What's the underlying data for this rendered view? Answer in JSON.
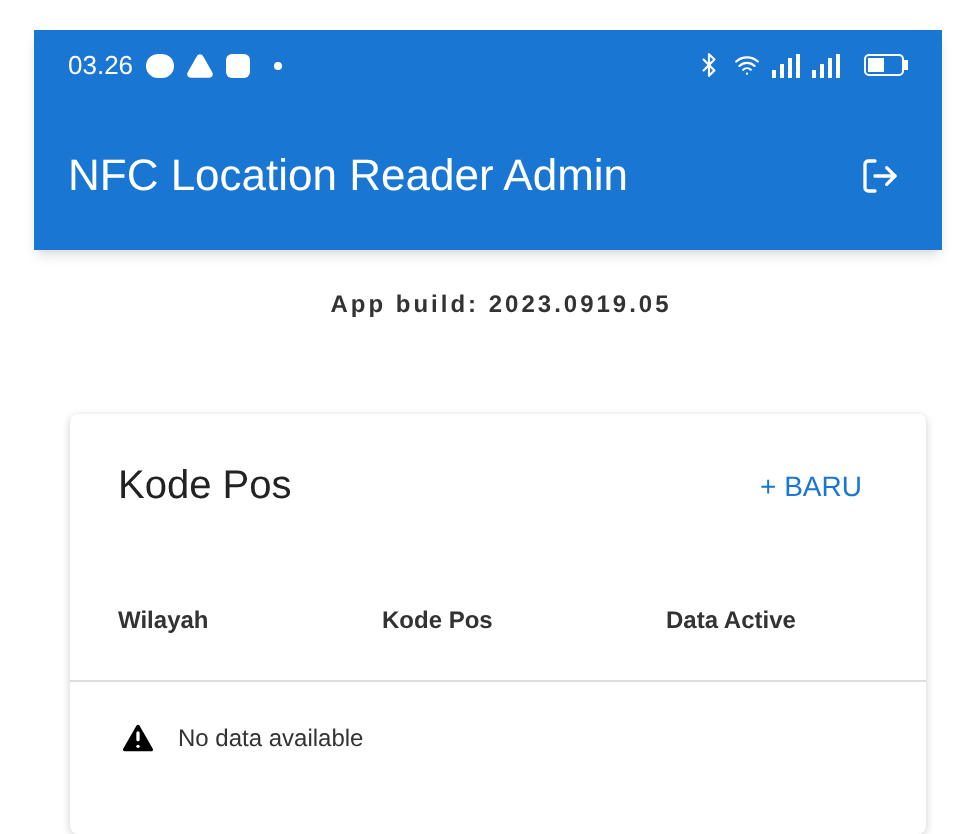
{
  "status_bar": {
    "time": "03.26"
  },
  "app_bar": {
    "title": "NFC Location Reader Admin"
  },
  "build_info": "App build: 2023.0919.05",
  "card": {
    "title": "Kode Pos",
    "new_button": "+ BARU",
    "table": {
      "columns": [
        "Wilayah",
        "Kode Pos",
        "Data Active"
      ],
      "empty_message": "No data available"
    }
  }
}
